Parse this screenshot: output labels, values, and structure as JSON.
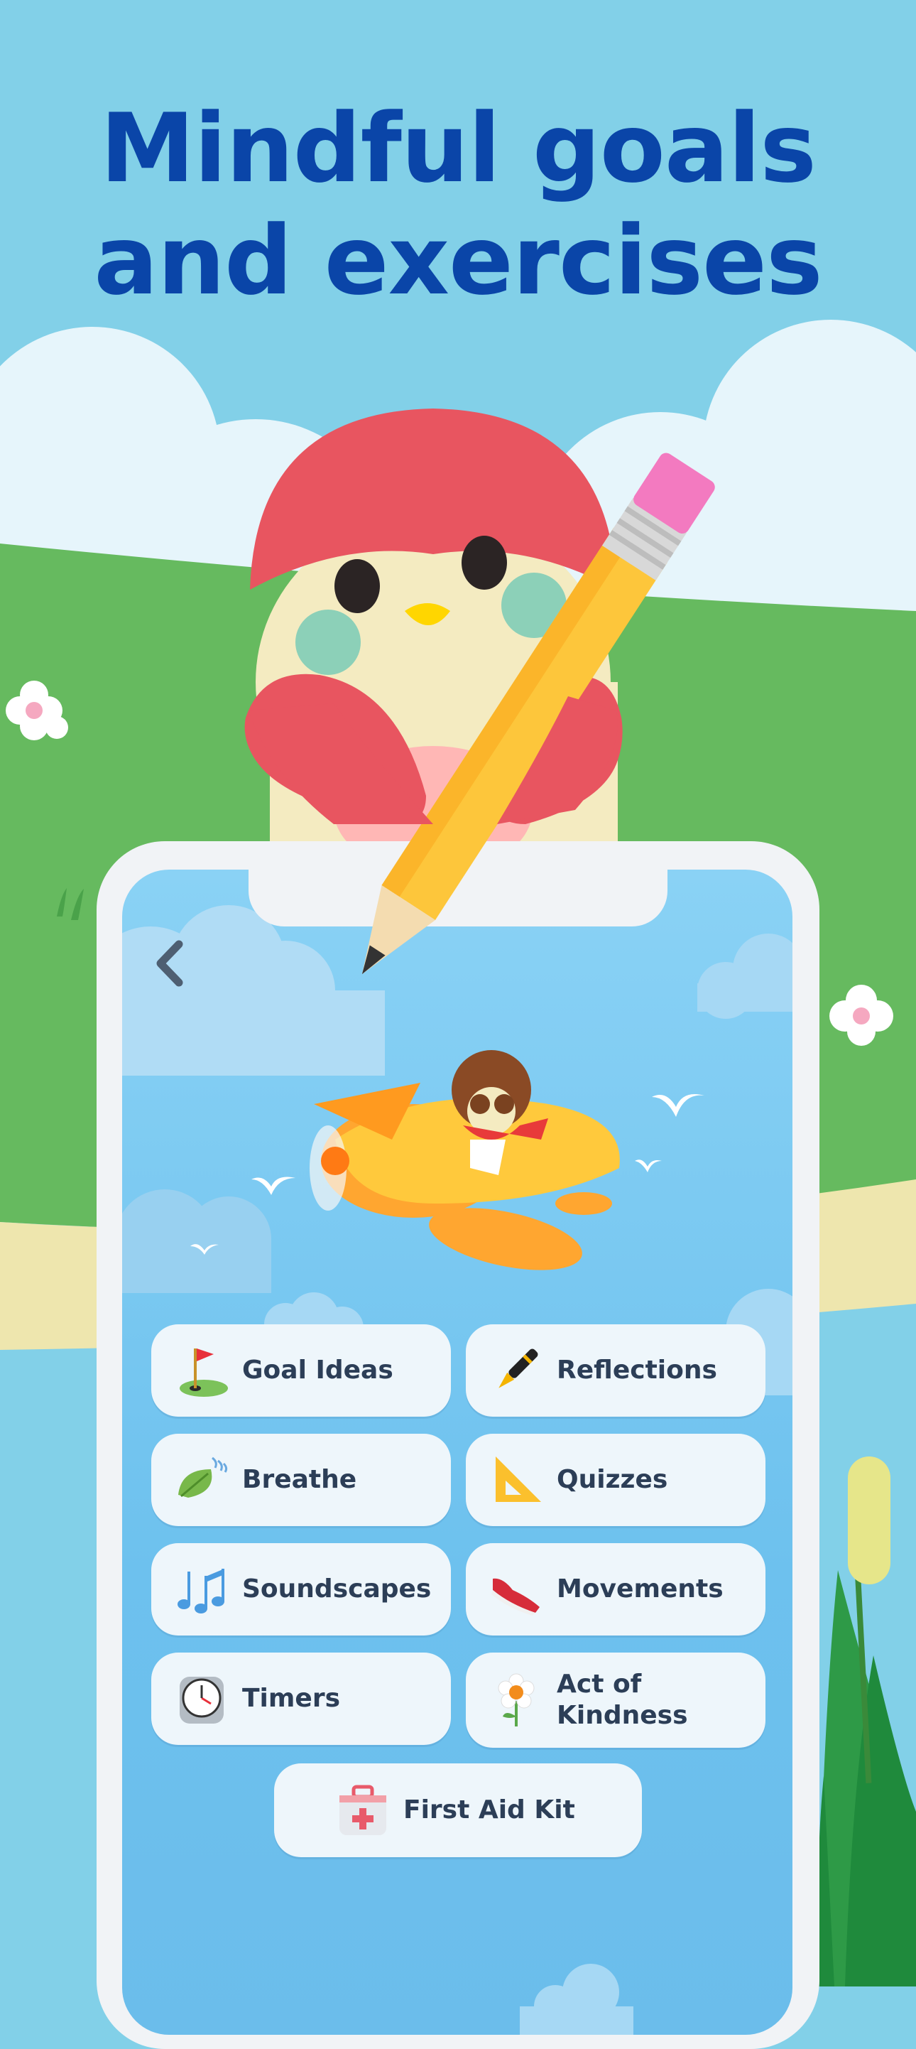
{
  "headline": {
    "line1": "Mindful goals",
    "line2": "and exercises"
  },
  "app_screen": {
    "back_icon": "chevron-left-icon",
    "menu": [
      {
        "label": "Goal Ideas",
        "icon": "golf-flag-icon"
      },
      {
        "label": "Reflections",
        "icon": "fountain-pen-icon"
      },
      {
        "label": "Breathe",
        "icon": "leaf-wind-icon"
      },
      {
        "label": "Quizzes",
        "icon": "triangle-ruler-icon"
      },
      {
        "label": "Soundscapes",
        "icon": "music-notes-icon"
      },
      {
        "label": "Movements",
        "icon": "sneaker-icon"
      },
      {
        "label": "Timers",
        "icon": "stopwatch-icon"
      },
      {
        "label": "Act of Kindness",
        "icon": "daisy-icon"
      },
      {
        "label": "First Aid Kit",
        "icon": "first-aid-kit-icon"
      }
    ]
  },
  "colors": {
    "headline": "#0a45a8",
    "sky": "#82d0e8",
    "grass": "#66ba5f",
    "button_bg": "#eef6fb",
    "button_text": "#2c3e57"
  }
}
